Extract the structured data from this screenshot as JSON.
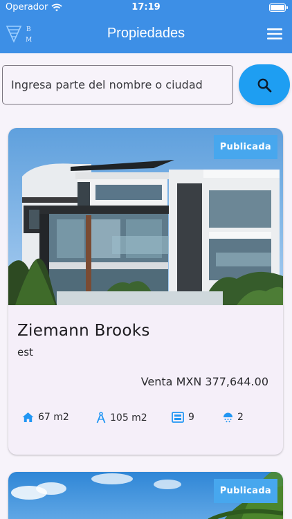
{
  "status_bar": {
    "carrier": "Operador",
    "time": "17:19",
    "battery_level": 1.0
  },
  "app_bar": {
    "title": "Propiedades",
    "logo_letters": [
      "B",
      "M"
    ]
  },
  "search": {
    "placeholder": "Ingresa parte del nombre o ciudad",
    "value": ""
  },
  "listings": [
    {
      "status": "Publicada",
      "name": "Ziemann Brooks",
      "subtitle": "est",
      "price": "Venta MXN 377,644.00",
      "built_area": "67 m2",
      "land_area": "105 m2",
      "rooms": "9",
      "baths": "2"
    },
    {
      "status": "Publicada"
    }
  ],
  "colors": {
    "primary": "#3d8fe6",
    "search_button": "#1e9ef2",
    "badge": "#47a7ee",
    "feature_icon": "#2196f3",
    "background": "#f7f3fa"
  },
  "icons": {
    "wifi": "wifi-icon",
    "battery": "battery-icon",
    "logo": "logo-icon",
    "menu": "menu-icon",
    "search": "search-icon",
    "home": "home-icon",
    "compass": "compass-icon",
    "rooms": "rooms-icon",
    "shower": "shower-icon"
  }
}
